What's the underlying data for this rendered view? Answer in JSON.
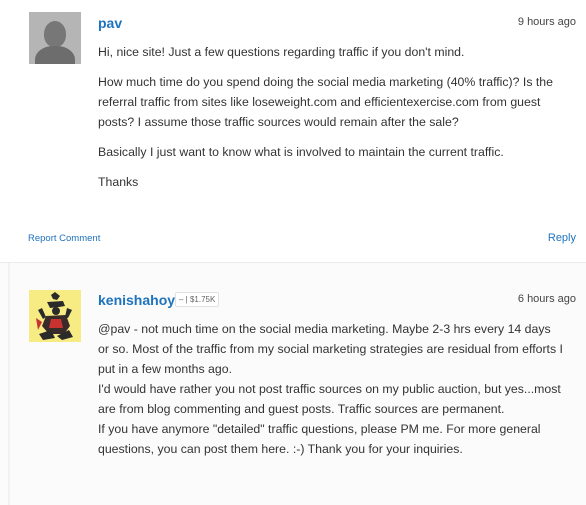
{
  "comments": [
    {
      "username": "pav",
      "time": "9 hours ago",
      "paragraphs": [
        "Hi, nice site! Just a few questions regarding traffic if you don't mind.",
        "How much time do you spend doing the social media marketing (40% traffic)? Is the referral traffic from sites like loseweight.com and efficientexercise.com from guest posts? I assume those traffic sources would remain after the sale?",
        "Basically I just want to know what is involved to maintain the current traffic.",
        "Thanks"
      ],
      "report_label": "Report Comment",
      "reply_label": "Reply"
    },
    {
      "username": "kenishahoy",
      "badge": "– | $1.75K",
      "time": "6 hours ago",
      "paragraphs": [
        "@pav - not much time on the social media marketing. Maybe 2-3 hrs every 14 days or so. Most of the traffic from my social marketing strategies are residual from efforts I put in a few months ago.",
        "I'd would have rather you not post traffic sources on my public auction, but yes...most are from blog commenting and guest posts. Traffic sources are permanent.",
        "If you have anymore \"detailed\" traffic questions, please PM me. For more general questions, you can post them here. :-) Thank you for your inquiries."
      ]
    }
  ],
  "icons": {
    "default_avatar": "default-avatar-icon",
    "custom_avatar": "samurai-avatar-icon"
  },
  "colors": {
    "link": "#1e73be",
    "text": "#333333",
    "avatar_bg_custom": "#f7ec84"
  }
}
